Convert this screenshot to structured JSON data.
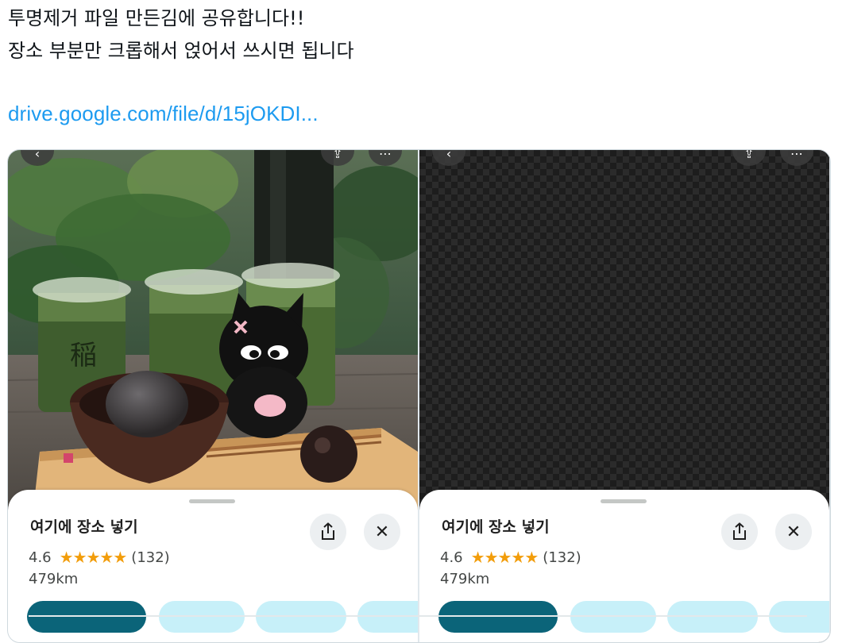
{
  "post": {
    "line1": "투명제거 파일 만든김에 공유합니다!!",
    "line2": "장소 부분만 크롭해서 얹어서 쓰시면 됩니다",
    "link": "drive.google.com/file/d/15jOKDI..."
  },
  "panels": [
    {
      "place_title": "여기에 장소 넣기",
      "rating": "4.6",
      "stars": "★★★★★",
      "reviews": "(132)",
      "distance": "479km",
      "icons": [
        "back-icon",
        "share-icon",
        "more-icon",
        "close-icon"
      ]
    },
    {
      "place_title": "여기에 장소 넣기",
      "rating": "4.6",
      "stars": "★★★★★",
      "reviews": "(132)",
      "distance": "479km",
      "icons": [
        "back-icon",
        "share-icon",
        "more-icon",
        "close-icon"
      ]
    }
  ],
  "colors": {
    "link": "#1d9bf0",
    "star": "#f29d0b",
    "primary_chip": "#0b6479",
    "secondary_chip": "#c7f0f9"
  }
}
